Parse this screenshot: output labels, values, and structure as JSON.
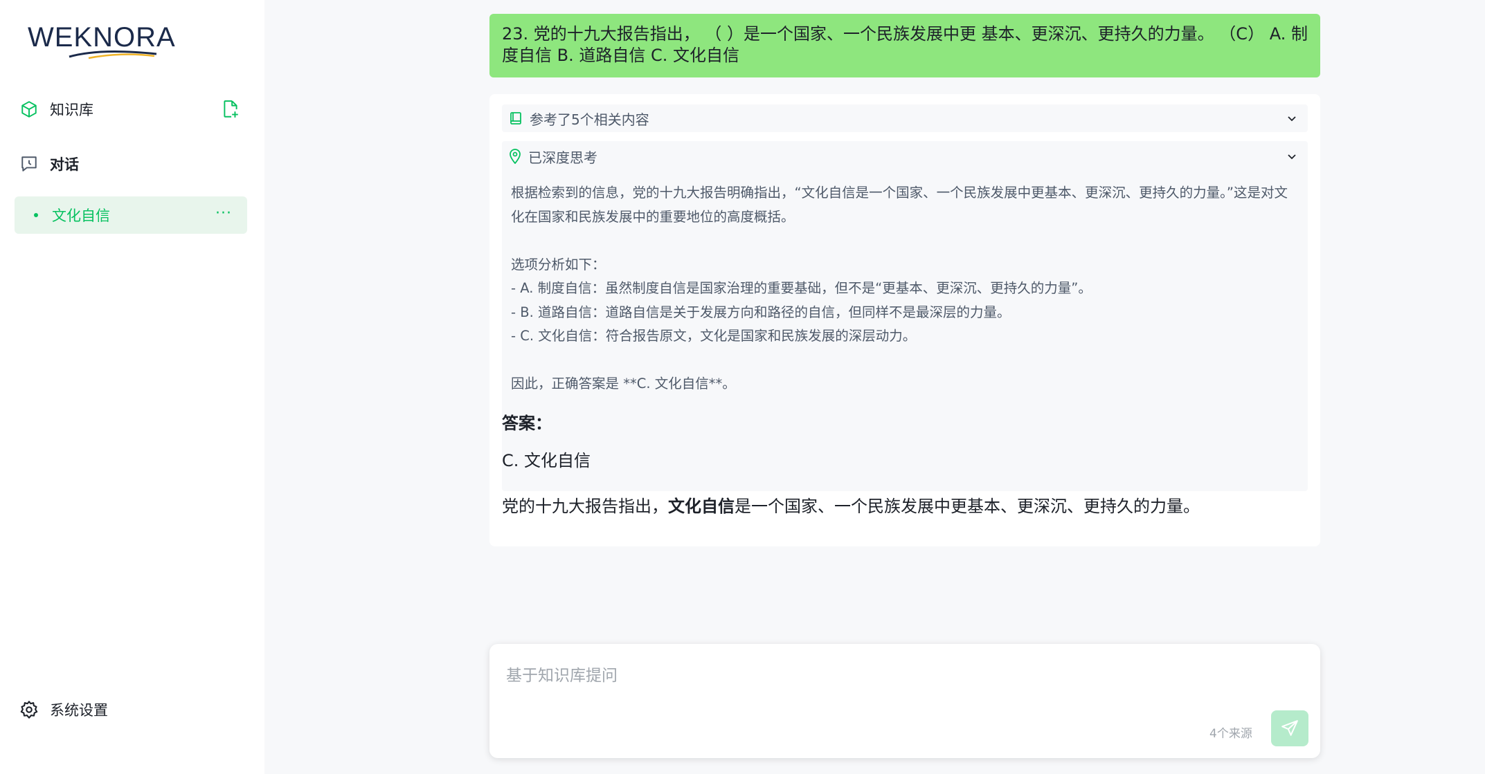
{
  "app": {
    "logo_text": "WEKNORA"
  },
  "sidebar": {
    "knowledge_base_label": "知识库",
    "chat_label": "对话",
    "sessions": [
      {
        "title": "文化自信",
        "more": "···"
      }
    ],
    "settings_label": "系统设置"
  },
  "conversation": {
    "question": "23. 党的十九大报告指出， （ ）是一个国家、一个民族发展中更 基本、更深沉、更持久的力量。 （C） A. 制度自信 B. 道路自信 C. 文化自信",
    "references_label": "参考了5个相关内容",
    "thinking_label": "已深度思考",
    "thinking_lines": [
      "根据检索到的信息，党的十九大报告明确指出，“文化自信是一个国家、一个民族发展中更基本、更深沉、更持久的力量。”这是对文化在国家和民族发展中的重要地位的高度概括。",
      "",
      "选项分析如下：",
      "- A. 制度自信：虽然制度自信是国家治理的重要基础，但不是“更基本、更深沉、更持久的力量”。",
      "- B. 道路自信：道路自信是关于发展方向和路径的自信，但同样不是最深层的力量。",
      "- C. 文化自信：符合报告原文，文化是国家和民族发展的深层动力。",
      "",
      "因此，正确答案是 **C. 文化自信**。"
    ],
    "answer_title": "答案：",
    "answer_choice": "C. 文化自信",
    "answer_text_before": "党的十九大报告指出，",
    "answer_text_bold": "文化自信",
    "answer_text_after": "是一个国家、一个民族发展中更基本、更深沉、更持久的力量。"
  },
  "input": {
    "placeholder": "基于知识库提问",
    "sources_label": "4个来源"
  },
  "colors": {
    "accent": "#07c160",
    "question_bg": "#8ee67e",
    "send_bg": "#b5ebcb"
  }
}
